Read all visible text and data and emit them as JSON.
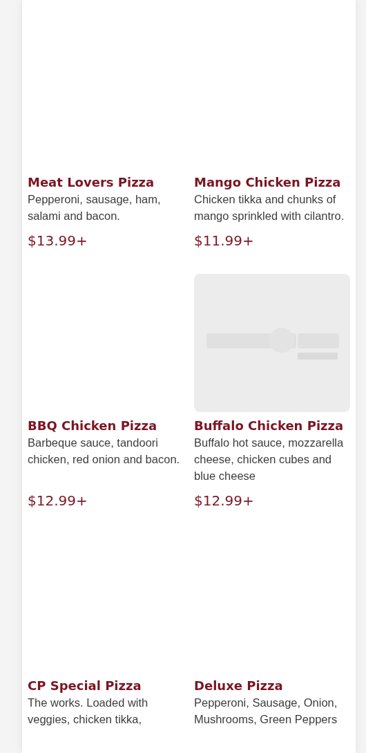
{
  "menu_items": [
    {
      "image": {
        "kind": "blank"
      },
      "name": "Meat Lovers Pizza",
      "description": "Pepperoni, sausage, ham, salami and bacon.",
      "price": "$13.99+"
    },
    {
      "image": {
        "kind": "blank"
      },
      "name": "Mango Chicken Pizza",
      "description": "Chicken tikka and chunks of mango sprinkled with cilantro.",
      "price": "$11.99+"
    },
    {
      "image": {
        "kind": "blank"
      },
      "name": "BBQ Chicken Pizza",
      "description": "Barbeque sauce, tandoori chicken, red onion and bacon.",
      "price": "$12.99+"
    },
    {
      "name": "Buffalo Chicken Pizza",
      "description": "Buffalo hot sauce, mozzarella cheese, chicken cubes and blue cheese",
      "price": "$12.99+"
    },
    {
      "image": {
        "kind": "blank"
      },
      "name": "CP Special Pizza",
      "description": "The works. Loaded with veggies, chicken tikka,"
    },
    {
      "image": {
        "kind": "blank"
      },
      "name": "Deluxe Pizza",
      "description": "Pepperoni, Sausage, Onion, Mushrooms, Green Peppers"
    }
  ]
}
